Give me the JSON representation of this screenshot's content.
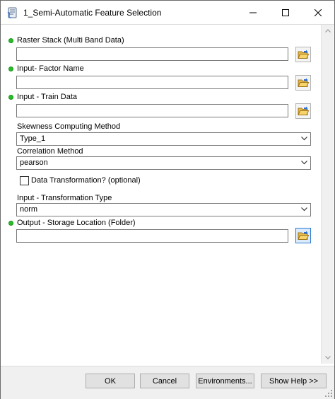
{
  "window": {
    "title": "1_Semi-Automatic Feature Selection",
    "app_icon": "python-script-icon"
  },
  "fields": {
    "raster_stack": {
      "label": "Raster Stack (Multi Band Data)",
      "value": ""
    },
    "factor_name": {
      "label": "Input- Factor Name",
      "value": ""
    },
    "train_data": {
      "label": "Input - Train Data",
      "value": ""
    },
    "skewness_method": {
      "label": "Skewness Computing Method",
      "value": "Type_1"
    },
    "correlation_method": {
      "label": "Correlation Method",
      "value": "pearson"
    },
    "data_transformation": {
      "label": "Data Transformation? (optional)",
      "checked": false
    },
    "transformation_type": {
      "label": "Input - Transformation Type",
      "value": "norm"
    },
    "output_location": {
      "label": "Output - Storage Location (Folder)",
      "value": ""
    }
  },
  "buttons": {
    "ok": "OK",
    "cancel": "Cancel",
    "environments": "Environments...",
    "show_help": "Show Help >>"
  },
  "colors": {
    "required_dot": "#25c025",
    "active_border": "#2e7ad1"
  }
}
